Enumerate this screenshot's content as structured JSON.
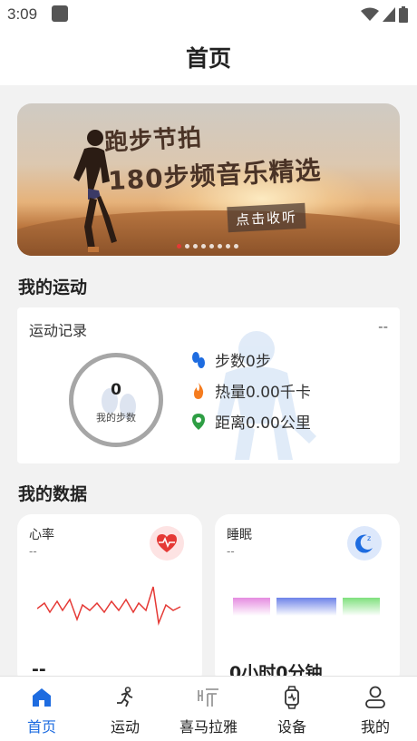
{
  "status_bar": {
    "time": "3:09"
  },
  "header": {
    "title": "首页"
  },
  "banner": {
    "line1": "跑步节拍",
    "line2": "180步频音乐精选",
    "cta": "点击收听",
    "dot_count": 8,
    "active_dot": 0,
    "accent": "#e53935"
  },
  "my_sport": {
    "section_title": "我的运动",
    "card_label": "运动记录",
    "dash": "--",
    "steps_value": "0",
    "steps_caption": "我的步数",
    "stats": [
      {
        "icon": "footprint-icon",
        "text": "步数0步",
        "color": "#1e6ce0"
      },
      {
        "icon": "flame-icon",
        "text": "热量0.00千卡",
        "color": "#f57c1f"
      },
      {
        "icon": "location-pin-icon",
        "text": "距离0.00公里",
        "color": "#2e9e44"
      }
    ]
  },
  "my_data": {
    "section_title": "我的数据",
    "heart": {
      "label": "心率",
      "sub": "--",
      "value": "--",
      "color": "#e53935"
    },
    "sleep": {
      "label": "睡眠",
      "sub": "--",
      "value": "0小时0分钟",
      "color": "#1e6ce0"
    }
  },
  "tabs": [
    {
      "label": "首页",
      "icon": "home-icon",
      "active": true
    },
    {
      "label": "运动",
      "icon": "runner-icon",
      "active": false
    },
    {
      "label": "喜马拉雅",
      "icon": "ximalaya-icon",
      "active": false
    },
    {
      "label": "设备",
      "icon": "watch-icon",
      "active": false
    },
    {
      "label": "我的",
      "icon": "person-icon",
      "active": false
    }
  ],
  "colors": {
    "accent": "#1e6ce0",
    "background": "#f2f2f2"
  }
}
